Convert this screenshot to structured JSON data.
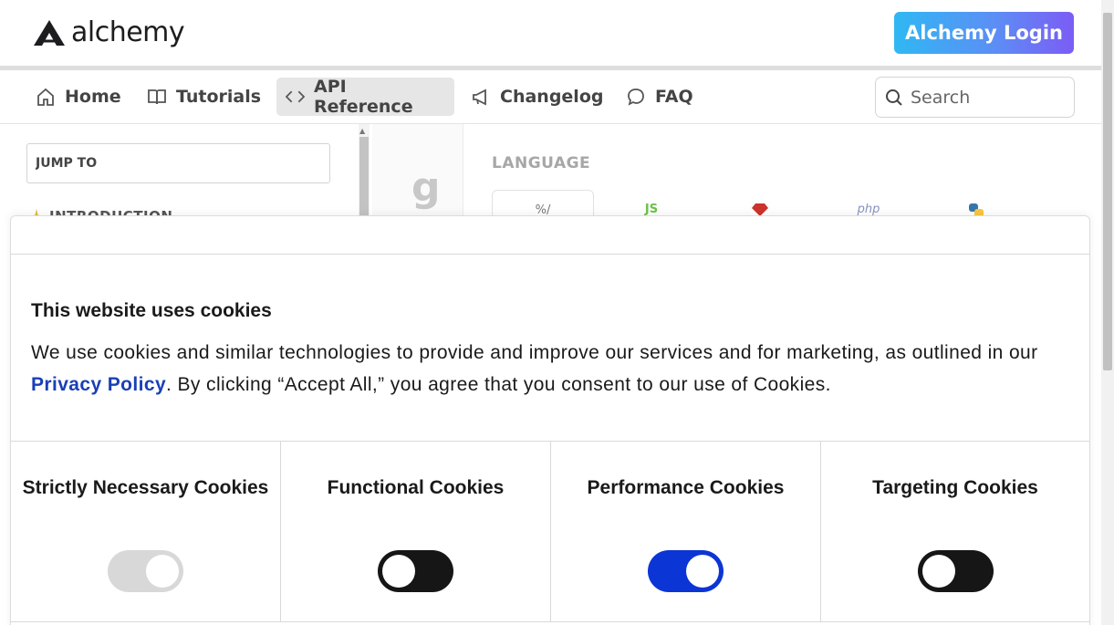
{
  "header": {
    "logo_text": "alchemy",
    "login_button": "Alchemy Login"
  },
  "nav": {
    "items": [
      {
        "label": "Home",
        "icon": "home-icon"
      },
      {
        "label": "Tutorials",
        "icon": "book-icon"
      },
      {
        "label": "API Reference",
        "icon": "code-icon",
        "active": true
      },
      {
        "label": "Changelog",
        "icon": "megaphone-icon"
      },
      {
        "label": "FAQ",
        "icon": "chat-bubble-icon"
      }
    ],
    "search_placeholder": "Search"
  },
  "sidebar": {
    "jump_to_placeholder": "JUMP TO",
    "section_label": "INTRODUCTION"
  },
  "main": {
    "partial_glyph": "g",
    "language_label": "LANGUAGE",
    "languages": [
      {
        "label": "%/",
        "icon": "shell-icon",
        "color": "#777777"
      },
      {
        "label": "JS",
        "icon": "node-icon",
        "color": "#6cc24a"
      },
      {
        "label": "",
        "icon": "ruby-icon",
        "color": "#cc342d"
      },
      {
        "label": "php",
        "icon": "php-icon",
        "color": "#8892bf"
      },
      {
        "label": "",
        "icon": "python-icon",
        "color": "#3776ab"
      }
    ]
  },
  "cookie_banner": {
    "title": "This website uses cookies",
    "description_before": "We use cookies and similar technologies to provide and improve our services and for marketing, as outlined in our ",
    "privacy_link": "Privacy Policy",
    "description_after": ". By clicking “Accept All,” you agree that you consent to our use of Cookies.",
    "categories": [
      {
        "title": "Strictly Necessary Cookies",
        "enabled": true,
        "locked": true
      },
      {
        "title": "Functional Cookies",
        "enabled": false,
        "locked": false
      },
      {
        "title": "Performance Cookies",
        "enabled": true,
        "locked": false
      },
      {
        "title": "Targeting Cookies",
        "enabled": false,
        "locked": false
      }
    ]
  },
  "colors": {
    "accent_blue": "#0c35d6",
    "link_blue": "#1a3fb7",
    "login_gradient_start": "#2fb8f3",
    "login_gradient_end": "#7c5cf5"
  }
}
